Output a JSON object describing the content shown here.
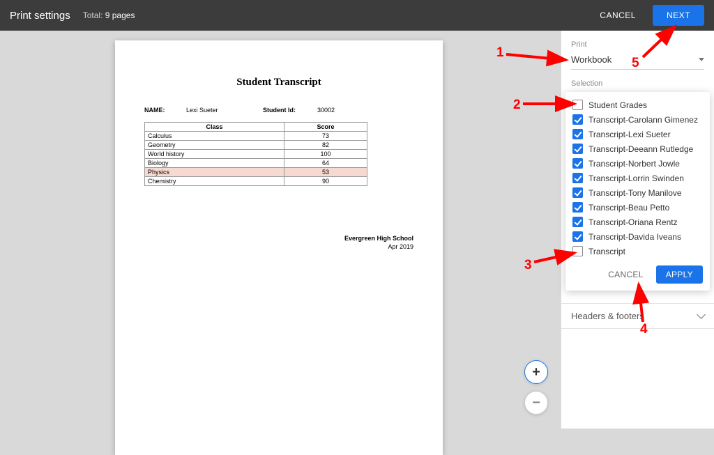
{
  "header": {
    "title": "Print settings",
    "total_label": "Total:",
    "total_value": "9 pages",
    "cancel": "CANCEL",
    "next": "NEXT"
  },
  "preview": {
    "doc_title": "Student Transcript",
    "name_label": "NAME:",
    "name_value": "Lexi Sueter",
    "id_label": "Student Id:",
    "id_value": "30002",
    "table": {
      "h_class": "Class",
      "h_score": "Score",
      "rows": [
        {
          "class": "Calculus",
          "score": "73",
          "hl": false
        },
        {
          "class": "Geometry",
          "score": "82",
          "hl": false
        },
        {
          "class": "World history",
          "score": "100",
          "hl": false
        },
        {
          "class": "Biology",
          "score": "64",
          "hl": false
        },
        {
          "class": "Physics",
          "score": "53",
          "hl": true
        },
        {
          "class": "Chemistry",
          "score": "90",
          "hl": false
        }
      ]
    },
    "school": "Evergreen High School",
    "date": "Apr 2019"
  },
  "panel": {
    "print_label": "Print",
    "print_value": "Workbook",
    "selection_label": "Selection",
    "items": [
      {
        "label": "Student Grades",
        "checked": false
      },
      {
        "label": "Transcript-Carolann Gimenez",
        "checked": true
      },
      {
        "label": "Transcript-Lexi Sueter",
        "checked": true
      },
      {
        "label": "Transcript-Deeann Rutledge",
        "checked": true
      },
      {
        "label": "Transcript-Norbert Jowle",
        "checked": true
      },
      {
        "label": "Transcript-Lorrin Swinden",
        "checked": true
      },
      {
        "label": "Transcript-Tony Manilove",
        "checked": true
      },
      {
        "label": "Transcript-Beau Petto",
        "checked": true
      },
      {
        "label": "Transcript-Oriana Rentz",
        "checked": true
      },
      {
        "label": "Transcript-Davida Iveans",
        "checked": true
      },
      {
        "label": "Transcript",
        "checked": false
      }
    ],
    "popup_cancel": "CANCEL",
    "popup_apply": "APPLY",
    "accordion": "Headers & footers"
  },
  "zoom": {
    "plus": "+",
    "minus": "−"
  },
  "annotations": {
    "n1": "1",
    "n2": "2",
    "n3": "3",
    "n4": "4",
    "n5": "5"
  }
}
